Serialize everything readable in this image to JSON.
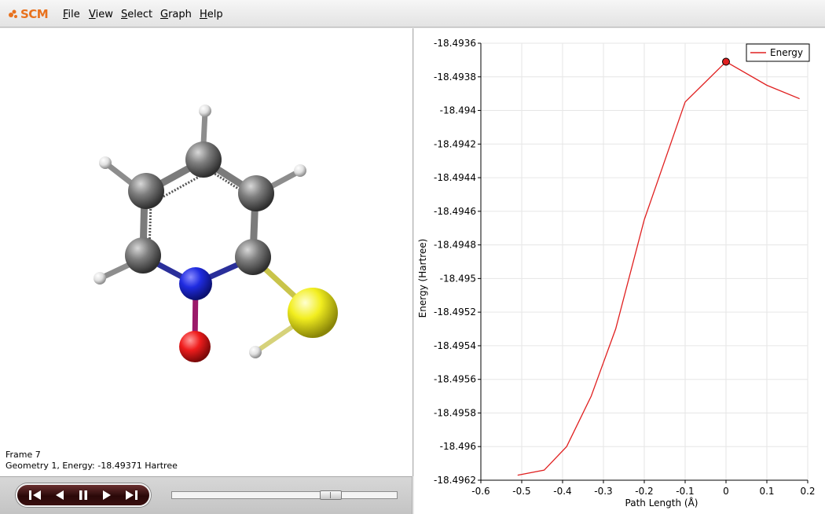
{
  "app": {
    "logo_text": "SCM",
    "menu": [
      {
        "label": "File",
        "mnemonic": "F",
        "rest": "ile"
      },
      {
        "label": "View",
        "mnemonic": "V",
        "rest": "iew"
      },
      {
        "label": "Select",
        "mnemonic": "S",
        "rest": "elect"
      },
      {
        "label": "Graph",
        "mnemonic": "G",
        "rest": "raph"
      },
      {
        "label": "Help",
        "mnemonic": "H",
        "rest": "elp"
      }
    ],
    "brand_color": "#e8711d"
  },
  "viewer": {
    "frame_label": "Frame 7",
    "geometry_label": "Geometry 1, Energy: -18.49371 Hartree",
    "atom_colors": {
      "carbon": "#7d7d7d",
      "hydrogen": "#f0f0f0",
      "nitrogen": "#1f2be0",
      "oxygen": "#ef1d1d",
      "sulfur": "#f2ee1f"
    }
  },
  "player": {
    "buttons": [
      "skip-to-start",
      "step-back",
      "pause",
      "step-forward",
      "skip-to-end"
    ],
    "slider_position": 0.73
  },
  "chart_data": {
    "type": "line",
    "title": "",
    "xlabel": "Path Length (Å)",
    "ylabel": "Energy (Hartree)",
    "xlim": [
      -0.6,
      0.2
    ],
    "ylim": [
      -18.4962,
      -18.4936
    ],
    "xticks": [
      -0.6,
      -0.5,
      -0.4,
      -0.3,
      -0.2,
      -0.1,
      0,
      0.1,
      0.2
    ],
    "xtick_labels": [
      "-0.6",
      "-0.5",
      "-0.4",
      "-0.3",
      "-0.2",
      "-0.1",
      "0",
      "0.1",
      "0.2"
    ],
    "yticks": [
      -18.4936,
      -18.4938,
      -18.494,
      -18.4942,
      -18.4944,
      -18.4946,
      -18.4948,
      -18.495,
      -18.4952,
      -18.4954,
      -18.4956,
      -18.4958,
      -18.496,
      -18.4962
    ],
    "ytick_labels": [
      "-18.4936",
      "-18.4938",
      "-18.494",
      "-18.4942",
      "-18.4944",
      "-18.4946",
      "-18.4948",
      "-18.495",
      "-18.4952",
      "-18.4954",
      "-18.4956",
      "-18.4958",
      "-18.496",
      "-18.4962"
    ],
    "grid": true,
    "legend": "top-right",
    "series": [
      {
        "name": "Energy",
        "color": "#e02020",
        "x": [
          -0.51,
          -0.445,
          -0.39,
          -0.33,
          -0.27,
          -0.2,
          -0.1,
          0.0,
          0.1,
          0.18
        ],
        "y": [
          -18.49617,
          -18.49614,
          -18.496,
          -18.4957,
          -18.4953,
          -18.49465,
          -18.49395,
          -18.49371,
          -18.49385,
          -18.49393
        ]
      }
    ],
    "highlight": {
      "x": 0.0,
      "y": -18.49371
    }
  }
}
